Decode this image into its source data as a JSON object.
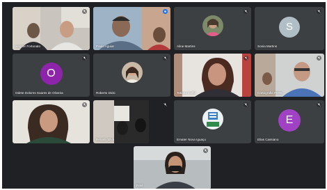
{
  "meeting": {
    "participants": [
      {
        "name": "wagner Fortunato",
        "mic": "muted"
      },
      {
        "name": "Paulo Aguiar",
        "mic": "speaking"
      },
      {
        "name": "Aline Martins",
        "mic": "muted"
      },
      {
        "name": "Sonia Martins",
        "mic": "muted",
        "initial": "S"
      },
      {
        "name": "Odete Dolores Soares de Oliveira",
        "mic": "muted",
        "initial": "O"
      },
      {
        "name": "Roberto Dicki",
        "mic": "muted"
      },
      {
        "name": "Tatiana Coffle",
        "mic": "muted"
      },
      {
        "name": "Cartografia PMNI",
        "mic": "muted"
      },
      {
        "name": "",
        "mic": "muted"
      },
      {
        "name": "Renata Silva",
        "mic": "muted"
      },
      {
        "name": "Emater Nova Iguaçu",
        "mic": "muted"
      },
      {
        "name": "Elias Cassiano",
        "mic": "muted",
        "initial": "E"
      },
      {
        "name": "Raul",
        "mic": "muted"
      }
    ]
  },
  "colors": {
    "background": "#202124",
    "tile": "#3c4043",
    "avatar_sonia": "#b0bec5",
    "avatar_odete": "#8e24aa",
    "avatar_elias": "#a142c4",
    "speaking_border": "#8ab4f8"
  },
  "icons": {
    "muted": "mic-off-icon",
    "speaking": "audio-wave-icon"
  }
}
